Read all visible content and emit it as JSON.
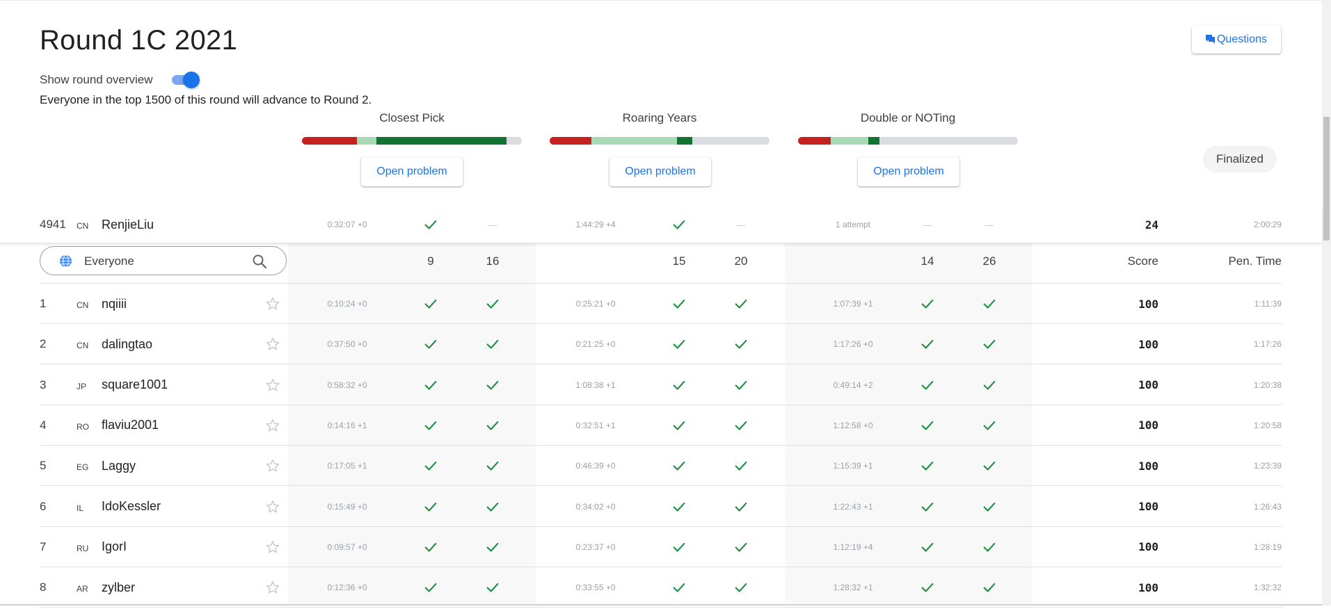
{
  "page": {
    "title": "Round 1C 2021"
  },
  "header": {
    "questions_label": "Questions",
    "questions_icon": "chat-bubbles-icon",
    "overview_label": "Show round overview",
    "overview_on": true,
    "advance_text": "Everyone in the top 1500 of this round will advance to Round 2.",
    "status": "Finalized"
  },
  "colors": {
    "accent": "#1a73e8",
    "wrong": "#c5221f",
    "partial": "#a8dab5",
    "full": "#137333",
    "check": "#1e8e3e"
  },
  "problems": [
    {
      "name": "Closest Pick",
      "button": "Open problem",
      "bar": {
        "wrong": 0.25,
        "partial": 0.09,
        "full": 0.59
      }
    },
    {
      "name": "Roaring Years",
      "button": "Open problem",
      "bar": {
        "wrong": 0.19,
        "partial": 0.39,
        "full": 0.07
      }
    },
    {
      "name": "Double or NOTing",
      "button": "Open problem",
      "bar": {
        "wrong": 0.15,
        "partial": 0.17,
        "full": 0.05
      }
    }
  ],
  "my_row": {
    "rank": "4941",
    "country": "CN",
    "name": "RenjieLiu",
    "problems": [
      {
        "time": "0:32:07 +0",
        "a": "check",
        "b": "dash"
      },
      {
        "time": "1:44:29 +4",
        "a": "check",
        "b": "dash"
      },
      {
        "time": "1 attempt",
        "a": "dash",
        "b": "dash"
      }
    ],
    "score": "24",
    "penalty": "2:00:29"
  },
  "search": {
    "value": "Everyone"
  },
  "table_header": {
    "points": [
      [
        "9",
        "16"
      ],
      [
        "15",
        "20"
      ],
      [
        "14",
        "26"
      ]
    ],
    "score_label": "Score",
    "penalty_label": "Pen. Time"
  },
  "rows": [
    {
      "rank": "1",
      "country": "CN",
      "name": "nqiiii",
      "times": [
        "0:10:24 +0",
        "0:25:21 +0",
        "1:07:39 +1"
      ],
      "score": "100",
      "penalty": "1:11:39"
    },
    {
      "rank": "2",
      "country": "CN",
      "name": "dalingtao",
      "times": [
        "0:37:50 +0",
        "0:21:25 +0",
        "1:17:26 +0"
      ],
      "score": "100",
      "penalty": "1:17:26"
    },
    {
      "rank": "3",
      "country": "JP",
      "name": "square1001",
      "times": [
        "0:58:32 +0",
        "1:08:38 +1",
        "0:49:14 +2"
      ],
      "score": "100",
      "penalty": "1:20:38"
    },
    {
      "rank": "4",
      "country": "RO",
      "name": "flaviu2001",
      "times": [
        "0:14:16 +1",
        "0:32:51 +1",
        "1:12:58 +0"
      ],
      "score": "100",
      "penalty": "1:20:58"
    },
    {
      "rank": "5",
      "country": "EG",
      "name": "Laggy",
      "times": [
        "0:17:05 +1",
        "0:46:39 +0",
        "1:15:39 +1"
      ],
      "score": "100",
      "penalty": "1:23:39"
    },
    {
      "rank": "6",
      "country": "IL",
      "name": "IdoKessler",
      "times": [
        "0:15:49 +0",
        "0:34:02 +0",
        "1:22:43 +1"
      ],
      "score": "100",
      "penalty": "1:26:43"
    },
    {
      "rank": "7",
      "country": "RU",
      "name": "IgorI",
      "times": [
        "0:09:57 +0",
        "0:23:37 +0",
        "1:12:19 +4"
      ],
      "score": "100",
      "penalty": "1:28:19"
    },
    {
      "rank": "8",
      "country": "AR",
      "name": "zylber",
      "times": [
        "0:12:36 +0",
        "0:33:55 +0",
        "1:28:32 +1"
      ],
      "score": "100",
      "penalty": "1:32:32"
    }
  ]
}
